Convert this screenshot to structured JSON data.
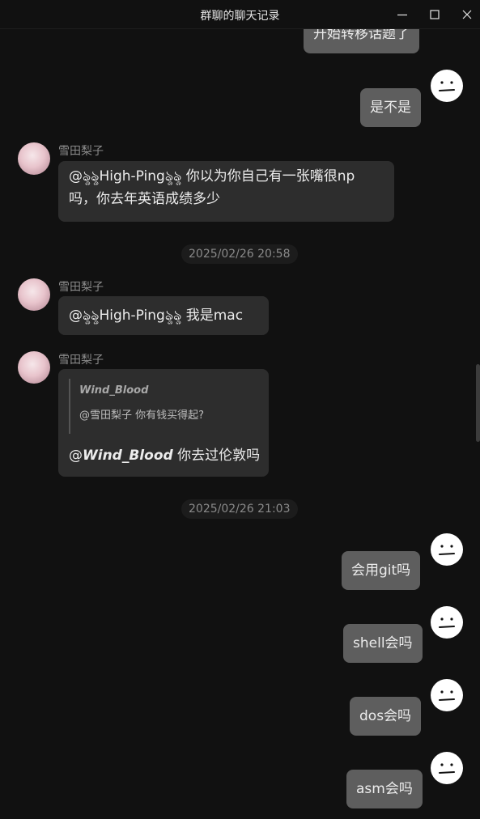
{
  "window": {
    "title": "群聊的聊天记录"
  },
  "messages": [
    {
      "text": "开始转移话题了"
    },
    {
      "text": "是不是"
    },
    {
      "sender": "雪田梨子",
      "line1": "@ৡৡHigh-Pingৡৡ 你以为你自己有一张嘴很np",
      "line2": "吗，你去年英语成绩多少"
    },
    {
      "text": "2025/02/26 20:58"
    },
    {
      "sender": "雪田梨子",
      "text": "@ৡৡHigh-Pingৡৡ 我是mac"
    },
    {
      "sender": "雪田梨子",
      "quote_author": "Wind_Blood",
      "quote_text": "@雪田梨子 你有钱买得起?",
      "reply_prefix": "@",
      "reply_mention": "Wind_Blood",
      "reply_text": " 你去过伦敦吗"
    },
    {
      "text": "2025/02/26 21:03"
    },
    {
      "text": "会用git吗"
    },
    {
      "text": "shell会吗"
    },
    {
      "text": "dos会吗"
    },
    {
      "text": "asm会吗"
    }
  ],
  "icons": {
    "minimize": "minimize-icon",
    "maximize": "maximize-icon",
    "close": "close-icon",
    "self_avatar": "meh-face-icon"
  },
  "colors": {
    "background": "#111111",
    "left_bubble": "#2d2d2d",
    "right_bubble": "#5e5e5e",
    "timestamp_pill": "#1c1c1c"
  }
}
